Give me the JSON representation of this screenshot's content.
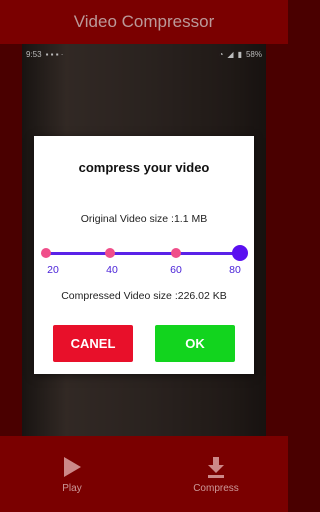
{
  "app": {
    "title": "Video Compressor"
  },
  "status_bar": {
    "time": "9:53",
    "battery": "58%"
  },
  "dialog": {
    "title": "compress your video",
    "original_size": "Original Video size :1.1 MB",
    "slider": {
      "ticks": [
        "20",
        "40",
        "60",
        "80"
      ],
      "value": "80"
    },
    "compressed_size": "Compressed Video size :226.02 KB",
    "cancel_label": "CANEL",
    "ok_label": "OK"
  },
  "bottom_nav": {
    "play_label": "Play",
    "compress_label": "Compress"
  },
  "colors": {
    "app_bar": "#7a0000",
    "slider_track": "#5a22e8",
    "slider_tick": "#f04e8a",
    "cancel": "#e8102a",
    "ok": "#12d41e"
  }
}
